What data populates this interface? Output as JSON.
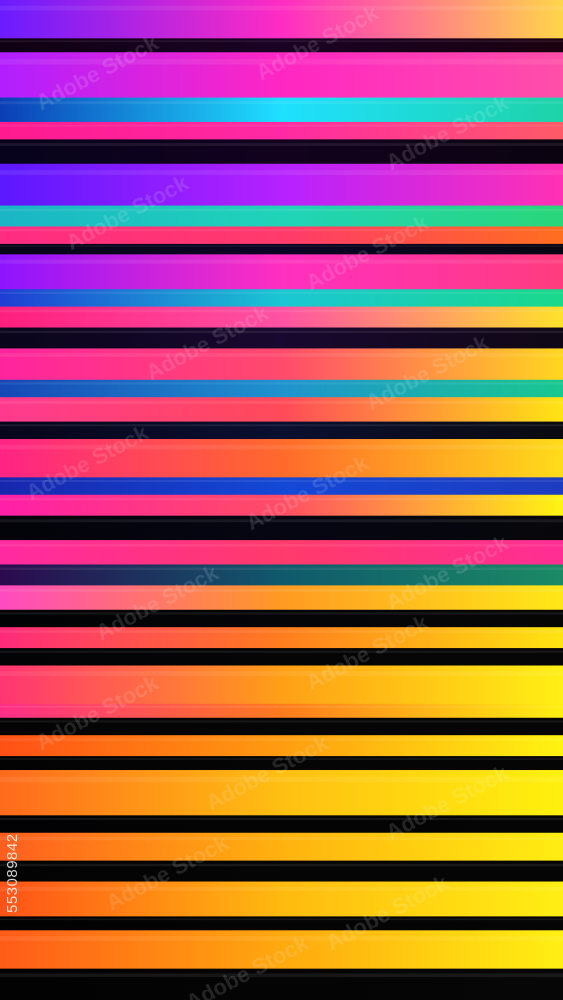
{
  "image": {
    "stock_id": "553089842",
    "watermark_text": "Adobe Stock"
  },
  "palette": {
    "black": "#030308",
    "magenta": "#ff1fc8",
    "purple": "#9b1cff",
    "cyan": "#1ee6d2",
    "teal": "#14b9a3",
    "blue": "#1638c8",
    "pink": "#ff3a86",
    "orange": "#ff8a1a",
    "yellow": "#ffee00"
  },
  "stripes": [
    [
      "#6a1cff",
      "#ff2cc3",
      "#ffd54a"
    ],
    [
      "#100014",
      "#1a0224",
      "#1b0010"
    ],
    [
      "#b01fff",
      "#ff27c3",
      "#ff4fa8"
    ],
    [
      "#0b3eb6",
      "#1fe0ff",
      "#1ed3a7"
    ],
    [
      "#ff1a8f",
      "#ff2aa3",
      "#ff5a67"
    ],
    [
      "#07031c",
      "#12021e",
      "#0b0310"
    ],
    [
      "#5b18ff",
      "#b621ff",
      "#ff31b4"
    ],
    [
      "#1ab5c6",
      "#20d4b8",
      "#2ad67a"
    ],
    [
      "#ff2c83",
      "#ff3a6b",
      "#ff6e1f"
    ],
    [
      "#060616",
      "#0b0524",
      "#080612"
    ],
    [
      "#8d14ff",
      "#ff2fc0",
      "#ff3c7d"
    ],
    [
      "#1e3dd4",
      "#1ac7d3",
      "#1ad98b"
    ],
    [
      "#ff1f7e",
      "#ff52a4",
      "#ffe12b"
    ],
    [
      "#09051a",
      "#19082f",
      "#100815"
    ],
    [
      "#ff249e",
      "#ff4a6c",
      "#ffd71f"
    ],
    [
      "#1648b6",
      "#1f93cf",
      "#19c88f"
    ],
    [
      "#ff3a8f",
      "#ff4a5a",
      "#ffe414"
    ],
    [
      "#07051a",
      "#0a0f2f",
      "#0a0a10"
    ],
    [
      "#ff2386",
      "#ff6a2b",
      "#ffdc1a"
    ],
    [
      "#1727ad",
      "#1448d6",
      "#1e3cc0"
    ],
    [
      "#ff1fa8",
      "#ff4d65",
      "#fff413"
    ],
    [
      "#030309",
      "#050612",
      "#07070b"
    ],
    [
      "#ff2aa0",
      "#ff3a6b",
      "#ff2e94"
    ],
    [
      "#2b0a4e",
      "#10596c",
      "#1b8a63"
    ],
    [
      "#ff4ac0",
      "#ff9a23",
      "#ffe818"
    ],
    [
      "#020204",
      "#050508",
      "#060605"
    ],
    [
      "#ff2a7b",
      "#ff7d1e",
      "#ffe412"
    ],
    [
      "#030306",
      "#050506",
      "#060606"
    ],
    [
      "#ff3574",
      "#ff9f17",
      "#fff015"
    ],
    [
      "#ff2e88",
      "#ff7b1e",
      "#ffef12"
    ],
    [
      "#030304",
      "#050505",
      "#050505"
    ],
    [
      "#ff5016",
      "#ff9c11",
      "#fff411"
    ],
    [
      "#030304",
      "#050505",
      "#050505"
    ],
    [
      "#ff6a1d",
      "#ffbf12",
      "#fff10e"
    ],
    [
      "#020204",
      "#040404",
      "#050505"
    ],
    [
      "#ff5e1f",
      "#ffb20f",
      "#ffee12"
    ],
    [
      "#030304",
      "#050505",
      "#050505"
    ],
    [
      "#ff5218",
      "#ffba10",
      "#ffef14"
    ],
    [
      "#020202",
      "#040404",
      "#050505"
    ],
    [
      "#ff5b19",
      "#ffa90f",
      "#fff013"
    ],
    [
      "#020202",
      "#040404",
      "#060606"
    ]
  ],
  "stripe_units": [
    22,
    8,
    26,
    14,
    10,
    14,
    24,
    12,
    10,
    6,
    20,
    10,
    12,
    12,
    18,
    10,
    14,
    10,
    22,
    10,
    12,
    14,
    14,
    12,
    14,
    10,
    12,
    10,
    22,
    8,
    10,
    12,
    8,
    26,
    10,
    16,
    12,
    20,
    8,
    22,
    18
  ]
}
